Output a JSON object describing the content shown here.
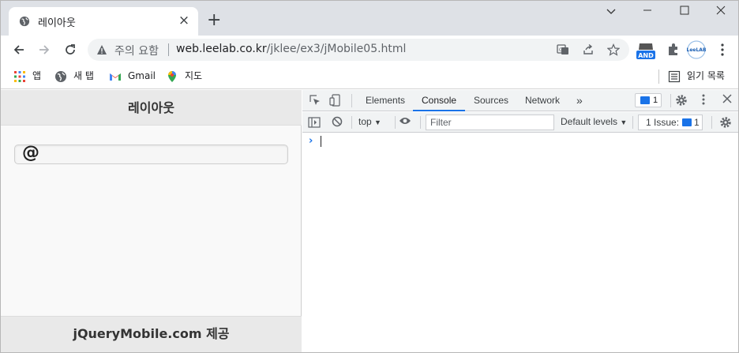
{
  "browser": {
    "tab": {
      "title": "레이아웃",
      "icon": "globe-icon"
    },
    "omnibox": {
      "security_label": "주의 요함",
      "url_host": "web.leelab.co.kr",
      "url_path": "/jklee/ex3/jMobile05.html"
    },
    "extensions": {
      "and_badge": "AND",
      "leelab_label": "LeeLAB"
    },
    "bookmarks": [
      {
        "label": "앱",
        "icon": "apps-grid-icon"
      },
      {
        "label": "새 탭",
        "icon": "globe-icon"
      },
      {
        "label": "Gmail",
        "icon": "gmail-icon"
      },
      {
        "label": "지도",
        "icon": "maps-pin-icon"
      }
    ],
    "reading_list": {
      "label": "읽기 목록",
      "icon": "reading-list-icon"
    }
  },
  "page": {
    "header_title": "레이아웃",
    "field_symbol": "@",
    "footer_text": "jQueryMobile.com 제공"
  },
  "devtools": {
    "tabs": [
      "Elements",
      "Console",
      "Sources",
      "Network"
    ],
    "active_tab": "Console",
    "more_tabs": "»",
    "message_count": "1",
    "context": "top",
    "filter_placeholder": "Filter",
    "levels": "Default levels",
    "issues_label": "1 Issue:",
    "issues_count": "1",
    "prompt": "›",
    "colors": {
      "accent": "#1a73e8"
    }
  }
}
